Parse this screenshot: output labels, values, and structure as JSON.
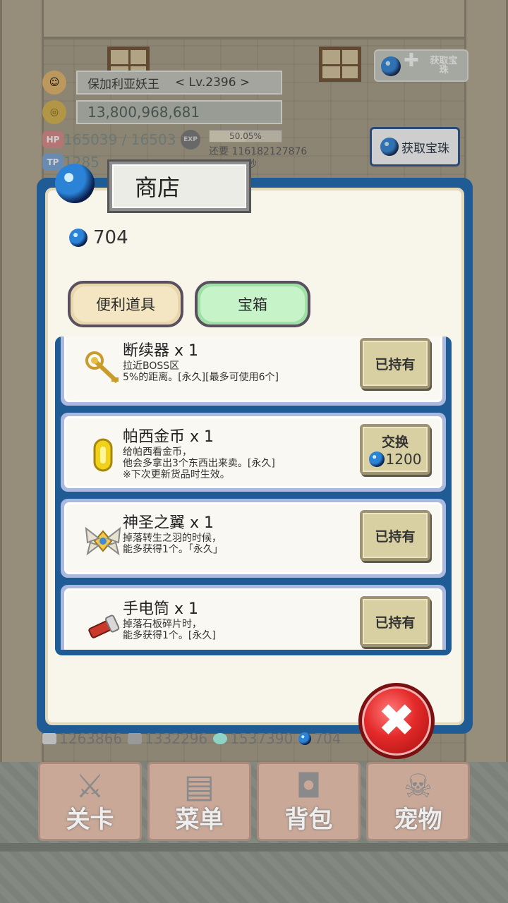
{
  "player": {
    "name": "保加利亚妖王",
    "level": "< Lv.2396 >",
    "gold": "13,800,968,681",
    "hp_label": "HP",
    "hp": "165039 / 16503",
    "exp_label": "EXP",
    "exp_percent_text": "50.05%",
    "exp_percent": 50.05,
    "exp_remaining": "还要 116182127876",
    "tp_label": "TP",
    "tp": "1285",
    "tp_suffix": "秒"
  },
  "header": {
    "get_orb_top": "获取宝珠",
    "get_orb_button": "获取宝珠"
  },
  "shop": {
    "title": "商店",
    "balance": "704",
    "tabs": [
      {
        "label": "便利道具",
        "active": false
      },
      {
        "label": "宝箱",
        "active": true
      }
    ],
    "items": [
      {
        "name": "断续器 x 1",
        "desc": "拉近BOSS区\n5%的距离。[永久][最多可使用6个]",
        "button": "已持有",
        "icon": "scepter-icon"
      },
      {
        "name": "帕西金币 x 1",
        "desc": "给帕西看金币，\n他会多拿出3个东西出来卖。[永久]\n※下次更新货品时生效。",
        "button": "交换",
        "price": "1200",
        "icon": "gold-coin-icon"
      },
      {
        "name": "神圣之翼 x 1",
        "desc": "掉落转生之羽的时候，\n能多获得1个。「永久」",
        "button": "已持有",
        "icon": "holy-wings-icon"
      },
      {
        "name": "手电筒 x 1",
        "desc": "掉落石板碎片时，\n能多获得1个。[永久]",
        "button": "已持有",
        "icon": "flashlight-icon"
      }
    ]
  },
  "resources": [
    "1263866",
    "1332296",
    "1537390",
    "704"
  ],
  "nav": [
    {
      "label": "关卡",
      "icon": "swords-icon"
    },
    {
      "label": "菜单",
      "icon": "book-icon"
    },
    {
      "label": "背包",
      "icon": "backpack-icon"
    },
    {
      "label": "宠物",
      "icon": "dragon-icon"
    }
  ],
  "colors": {
    "panel_border": "#1f5b94",
    "tab_active": "#c6f3c8",
    "tab_inactive": "#f4e6c2",
    "close": "#e42a2a"
  }
}
